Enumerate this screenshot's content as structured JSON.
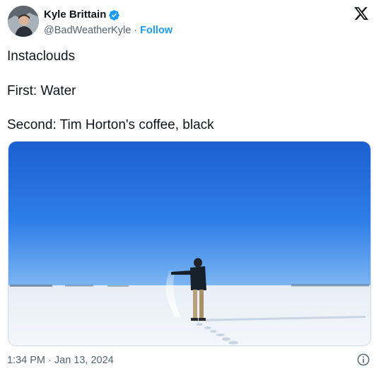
{
  "author": {
    "name": "Kyle Brittain",
    "handle": "@BadWeatherKyle",
    "separator": "·",
    "follow_label": "Follow",
    "verified_icon": "verified-badge-icon",
    "verified_color": "#1d9bf0"
  },
  "tweet": {
    "lines": [
      "Instaclouds",
      "First: Water",
      "Second: Tim Horton's coffee, black"
    ]
  },
  "media": {
    "type": "animated-gif"
  },
  "footer": {
    "timestamp": "1:34 PM · Jan 13, 2024",
    "info_icon": "info-icon"
  },
  "brand": {
    "logo": "x-logo-icon"
  },
  "colors": {
    "text": "#0f1419",
    "muted": "#536471",
    "accent": "#1d9bf0"
  }
}
